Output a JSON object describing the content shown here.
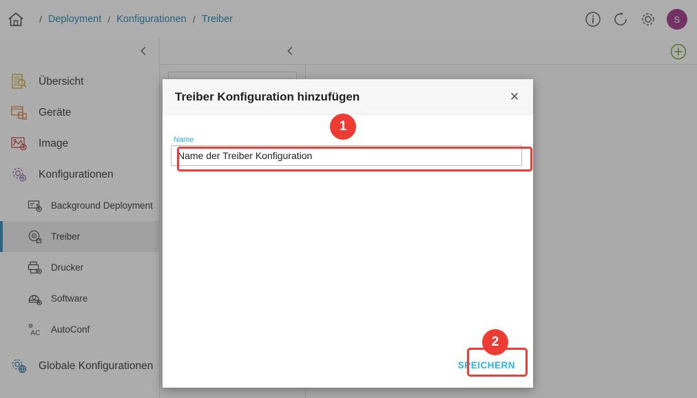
{
  "topbar": {
    "home_icon": "home-icon",
    "breadcrumbs": [
      {
        "label": "Deployment"
      },
      {
        "label": "Konfigurationen"
      },
      {
        "label": "Treiber"
      }
    ],
    "separator": "/",
    "icons": [
      {
        "name": "info-icon"
      },
      {
        "name": "refresh-icon"
      },
      {
        "name": "gear-icon"
      }
    ],
    "avatar_initial": "S",
    "avatar_color": "#9c2a82"
  },
  "sidebar": {
    "collapse_icon": "chevron-left-icon",
    "items": [
      {
        "label": "Übersicht",
        "icon": "document-search-icon",
        "color": "#c9a227"
      },
      {
        "label": "Geräte",
        "icon": "devices-icon",
        "color": "#d7762b"
      },
      {
        "label": "Image",
        "icon": "image-settings-icon",
        "color": "#c03a32"
      },
      {
        "label": "Konfigurationen",
        "icon": "gear-config-icon",
        "color": "#8b5fa8"
      }
    ],
    "sub_items": [
      {
        "label": "Background Deployment",
        "icon": "background-deployment-icon",
        "active": false
      },
      {
        "label": "Treiber",
        "icon": "driver-disc-icon",
        "active": true
      },
      {
        "label": "Drucker",
        "icon": "printer-icon",
        "active": false
      },
      {
        "label": "Software",
        "icon": "software-disc-icon",
        "active": false
      },
      {
        "label": "AutoConf",
        "icon": "autoconf-icon",
        "active": false
      }
    ],
    "global_item": {
      "label": "Globale Konfigurationen",
      "icon": "globe-gear-icon",
      "color": "#2a6f97"
    },
    "active_accent_color": "#1f84b5"
  },
  "content": {
    "back_icon": "chevron-left-icon",
    "add_icon": "add-circle-icon",
    "add_icon_color": "#6a9a23"
  },
  "modal": {
    "title": "Treiber Konfiguration hinzufügen",
    "close_icon": "close-icon",
    "close_glyph": "✕",
    "field": {
      "label": "Name",
      "value": "",
      "placeholder": "Name der Treiber Konfiguration"
    },
    "save_label": "SPEICHERN",
    "accent_color": "#29b4e8"
  },
  "annotations": {
    "highlight_color": "#ee3b33",
    "badges": [
      {
        "number": "1",
        "target": "name-input"
      },
      {
        "number": "2",
        "target": "save-button"
      }
    ]
  }
}
